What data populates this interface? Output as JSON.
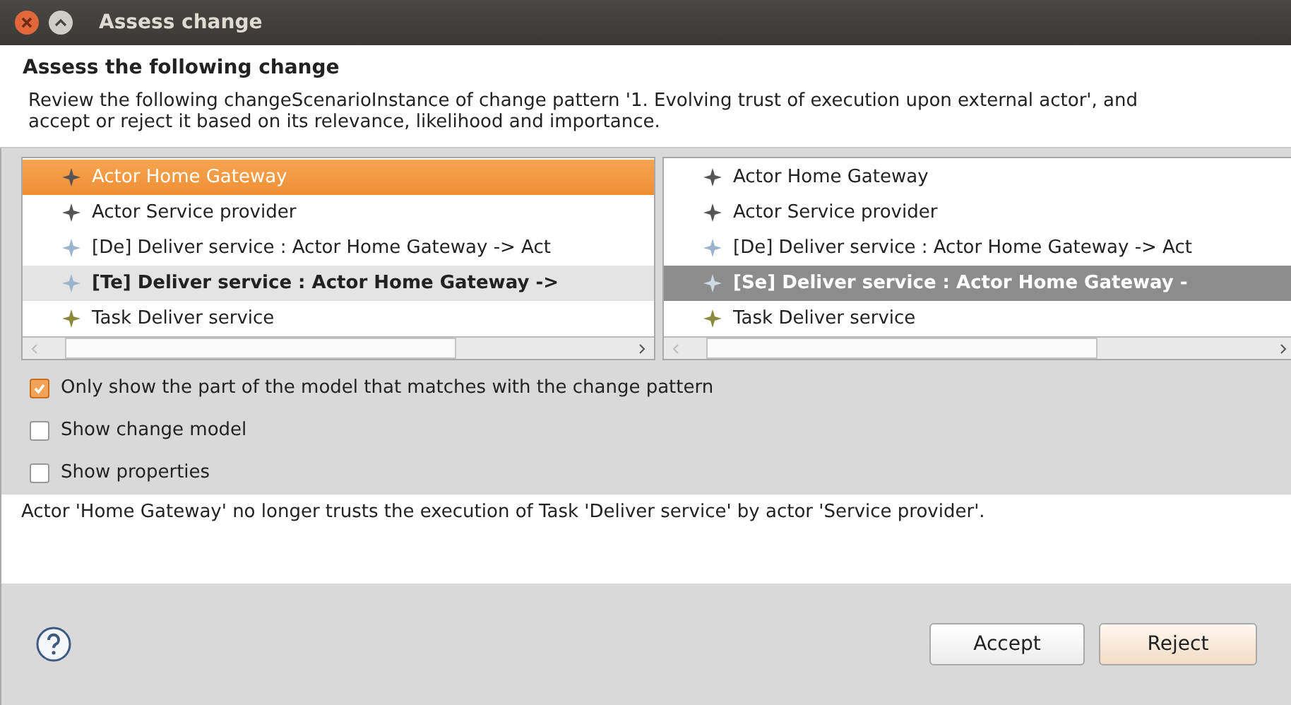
{
  "window": {
    "title": "Assess change"
  },
  "header": {
    "title": "Assess the following change",
    "description": "Review the following changeScenarioInstance of change pattern '1. Evolving trust of execution upon external actor', and accept or reject it based on its relevance, likelihood and importance."
  },
  "trees": [
    {
      "focused": true,
      "items": [
        {
          "kind": "actor",
          "label": "Actor Home Gateway",
          "selected": true,
          "bold": false
        },
        {
          "kind": "actor",
          "label": "Actor Service provider",
          "selected": false,
          "bold": false
        },
        {
          "kind": "flow",
          "label": "[De] Deliver service : Actor Home Gateway -> Act",
          "selected": false,
          "bold": false
        },
        {
          "kind": "flow",
          "label": "[Te] Deliver service : Actor Home Gateway ->",
          "selected": false,
          "bold": true
        },
        {
          "kind": "task",
          "label": "Task Deliver service",
          "selected": false,
          "bold": false
        }
      ]
    },
    {
      "focused": false,
      "items": [
        {
          "kind": "actor",
          "label": "Actor Home Gateway",
          "selected": false,
          "bold": false
        },
        {
          "kind": "actor",
          "label": "Actor Service provider",
          "selected": false,
          "bold": false
        },
        {
          "kind": "flow",
          "label": "[De] Deliver service : Actor Home Gateway -> Act",
          "selected": false,
          "bold": false
        },
        {
          "kind": "flow",
          "label": "[Se] Deliver service : Actor Home Gateway -",
          "selected": true,
          "bold": true
        },
        {
          "kind": "task",
          "label": "Task Deliver service",
          "selected": false,
          "bold": false
        }
      ]
    }
  ],
  "options": [
    {
      "label": "Only show the part of the model that matches with the change pattern",
      "checked": true
    },
    {
      "label": "Show change model",
      "checked": false
    },
    {
      "label": "Show properties",
      "checked": false
    }
  ],
  "description": "Actor 'Home Gateway' no longer trusts the execution of Task 'Deliver service' by actor 'Service provider'.",
  "buttons": [
    {
      "label": "Accept",
      "kind": "normal"
    },
    {
      "label": "Reject",
      "kind": "default"
    }
  ]
}
